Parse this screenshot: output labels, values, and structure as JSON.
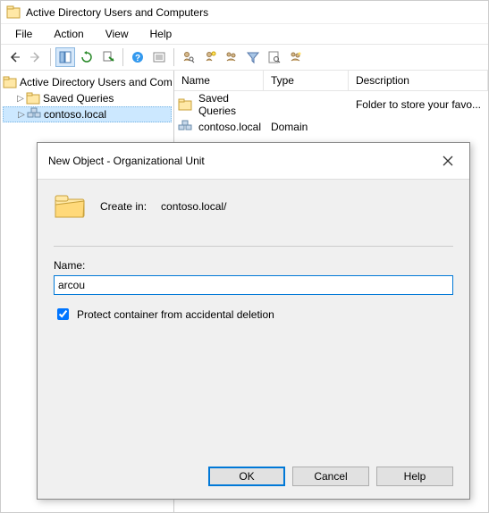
{
  "app": {
    "title": "Active Directory Users and Computers"
  },
  "menu": {
    "file": "File",
    "action": "Action",
    "view": "View",
    "help": "Help"
  },
  "tree": {
    "root": "Active Directory Users and Com",
    "items": [
      {
        "label": "Saved Queries"
      },
      {
        "label": "contoso.local",
        "selected": true
      }
    ]
  },
  "list": {
    "headers": {
      "name": "Name",
      "type": "Type",
      "desc": "Description"
    },
    "rows": [
      {
        "name": "Saved Queries",
        "type": "",
        "desc": "Folder to store your favo..."
      },
      {
        "name": "contoso.local",
        "type": "Domain",
        "desc": ""
      }
    ]
  },
  "dialog": {
    "title": "New Object - Organizational Unit",
    "create_in_label": "Create in:",
    "create_in_path": "contoso.local/",
    "name_label": "Name:",
    "name_value": "arcou",
    "protect_label": "Protect container from accidental deletion",
    "protect_checked": true,
    "ok": "OK",
    "cancel": "Cancel",
    "help": "Help"
  }
}
